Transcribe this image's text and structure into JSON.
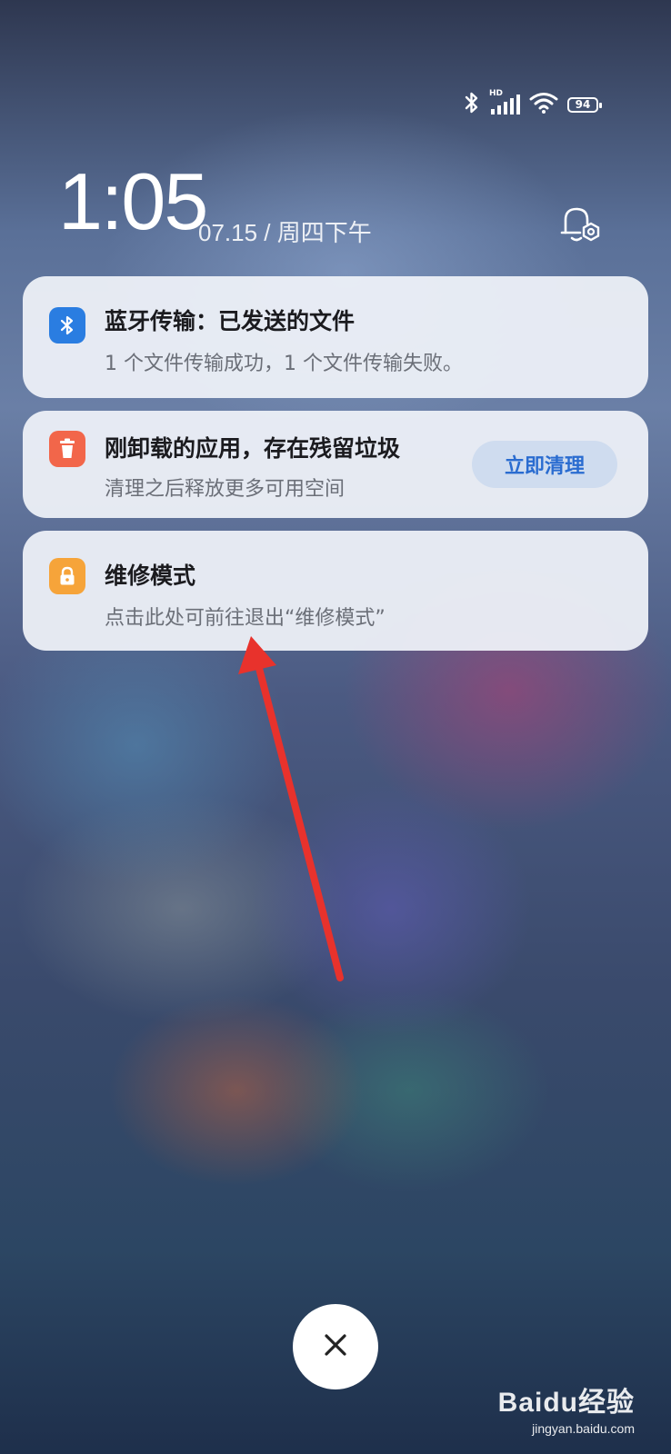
{
  "status_bar": {
    "icons": [
      "bluetooth-icon",
      "hd-signal-icon",
      "wifi-icon"
    ],
    "network_badge": "HD",
    "battery_level": "94"
  },
  "lockscreen": {
    "time": "1:05",
    "date": "07.15 / 周四下午",
    "settings_icon": "notification-settings-icon"
  },
  "notifications": [
    {
      "icon": "bluetooth-icon",
      "icon_color": "#2a7de1",
      "title": "蓝牙传输：已发送的文件",
      "body": "1 个文件传输成功，1 个文件传输失败。"
    },
    {
      "icon": "trash-icon",
      "icon_color": "#f2664a",
      "title": "刚卸载的应用，存在残留垃圾",
      "body": "清理之后释放更多可用空间",
      "action_label": "立即清理"
    },
    {
      "icon": "lock-icon",
      "icon_color": "#f6a43a",
      "title": "维修模式",
      "body": "点击此处可前往退出“维修模式”"
    }
  ],
  "close_button": {
    "icon": "close-icon"
  },
  "annotation": {
    "icon": "red-arrow-annotation"
  },
  "watermark": {
    "logo": "Baidu经验",
    "site": "jingyan.baidu.com"
  },
  "colors": {
    "accent": "#2a6cd0",
    "annotation_red": "#e8322c"
  }
}
